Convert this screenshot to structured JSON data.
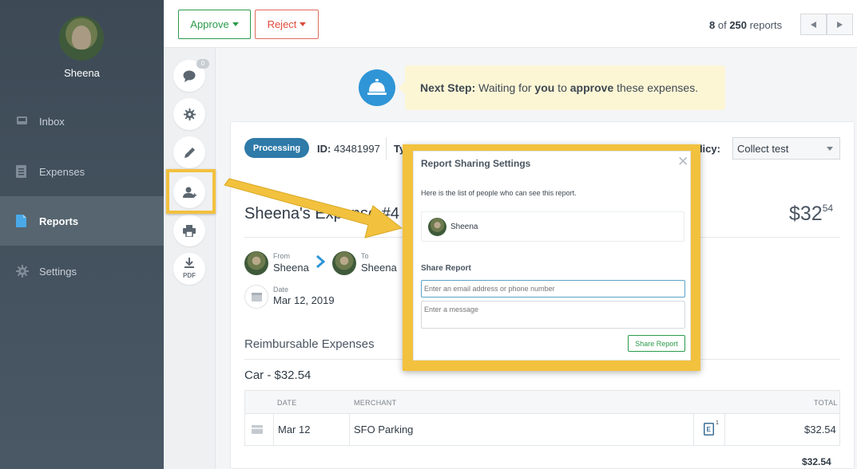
{
  "user": {
    "name": "Sheena"
  },
  "sidebar": {
    "items": [
      {
        "label": "Inbox",
        "icon": "inbox-icon",
        "active": false
      },
      {
        "label": "Expenses",
        "icon": "expenses-icon",
        "active": false
      },
      {
        "label": "Reports",
        "icon": "reports-icon",
        "active": true
      },
      {
        "label": "Settings",
        "icon": "gear-icon",
        "active": false
      }
    ]
  },
  "toolbar": {
    "approve_label": "Approve",
    "reject_label": "Reject",
    "pager_current": "8",
    "pager_of": "of",
    "pager_total": "250",
    "pager_unit": "reports"
  },
  "rail": {
    "comment_count": "0",
    "pdf_label": "PDF"
  },
  "next_step": {
    "prefix": "Next Step:",
    "text1": " Waiting for ",
    "you": "you",
    "text2": " to ",
    "approve": "approve",
    "text3": " these expenses."
  },
  "report": {
    "status": "Processing",
    "id_label": "ID:",
    "id_value": "43481997",
    "type_partial": "Ty",
    "policy_partial": "olicy:",
    "policy_value": "Collect test",
    "title_partial": "Sheena's Expense #4",
    "amount_main": "$32",
    "amount_cents": "54",
    "from_label": "From",
    "from_name": "Sheena",
    "to_label": "To",
    "to_name": "Sheena",
    "date_label": "Date",
    "date_value": "Mar 12, 2019",
    "section_title": "Reimbursable Expenses",
    "category_title": "Car - $32.54",
    "columns": {
      "date": "DATE",
      "merchant": "MERCHANT",
      "total": "TOTAL"
    },
    "rows": [
      {
        "date": "Mar 12",
        "merchant": "SFO Parking",
        "receipt_count": "1",
        "total": "$32.54"
      }
    ],
    "grand_total": "$32.54"
  },
  "modal": {
    "title": "Report Sharing Settings",
    "description": "Here is the list of people who can see this report.",
    "shared_with": [
      {
        "name": "Sheena"
      }
    ],
    "share_label": "Share Report",
    "email_placeholder": "Enter an email address or phone number",
    "message_placeholder": "Enter a message",
    "share_button": "Share Report"
  },
  "colors": {
    "approve": "#2b9a4a",
    "reject": "#e04a3a",
    "accent_blue": "#2f95d6",
    "highlight": "#f2c13e",
    "sidebar_bg": "#3d4a56"
  }
}
